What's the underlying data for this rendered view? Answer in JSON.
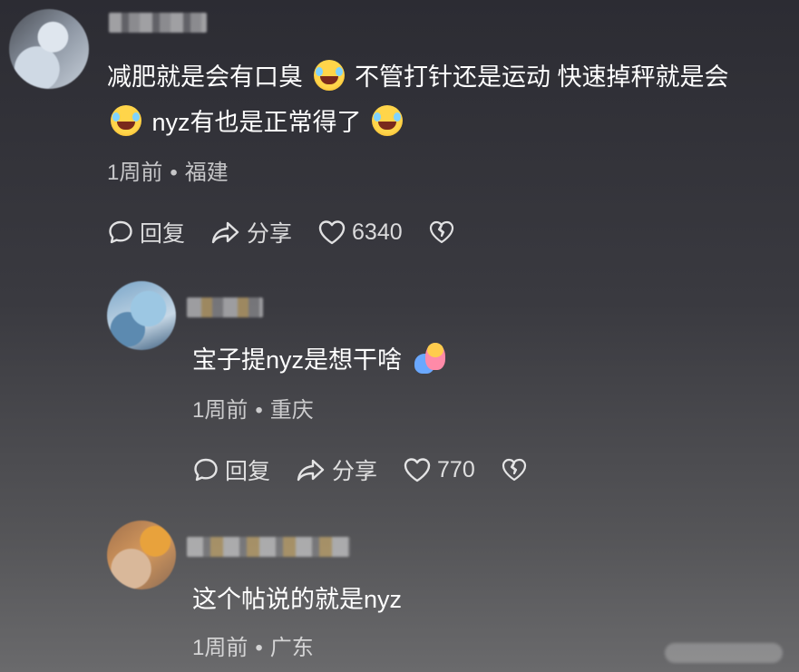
{
  "comments": [
    {
      "line1": "减肥就是会有口臭",
      "line1b": "不管打针还是运动 快速掉秤就是会",
      "line2": "nyz有也是正常得了",
      "time": "1周前",
      "location": "福建",
      "reply_label": "回复",
      "share_label": "分享",
      "likes": "6340"
    },
    {
      "text": "宝子提nyz是想干啥",
      "time": "1周前",
      "location": "重庆",
      "reply_label": "回复",
      "share_label": "分享",
      "likes": "770"
    },
    {
      "text": "这个帖说的就是nyz",
      "time": "1周前",
      "location": "广东"
    }
  ],
  "separator": "•",
  "icons": {
    "reply": "reply-bubble-icon",
    "share": "share-arrow-icon",
    "like": "heart-icon",
    "dislike": "broken-heart-icon",
    "emoji_laugh": "rolling-laugh-emoji",
    "emoji_hug": "hug-emoji"
  }
}
